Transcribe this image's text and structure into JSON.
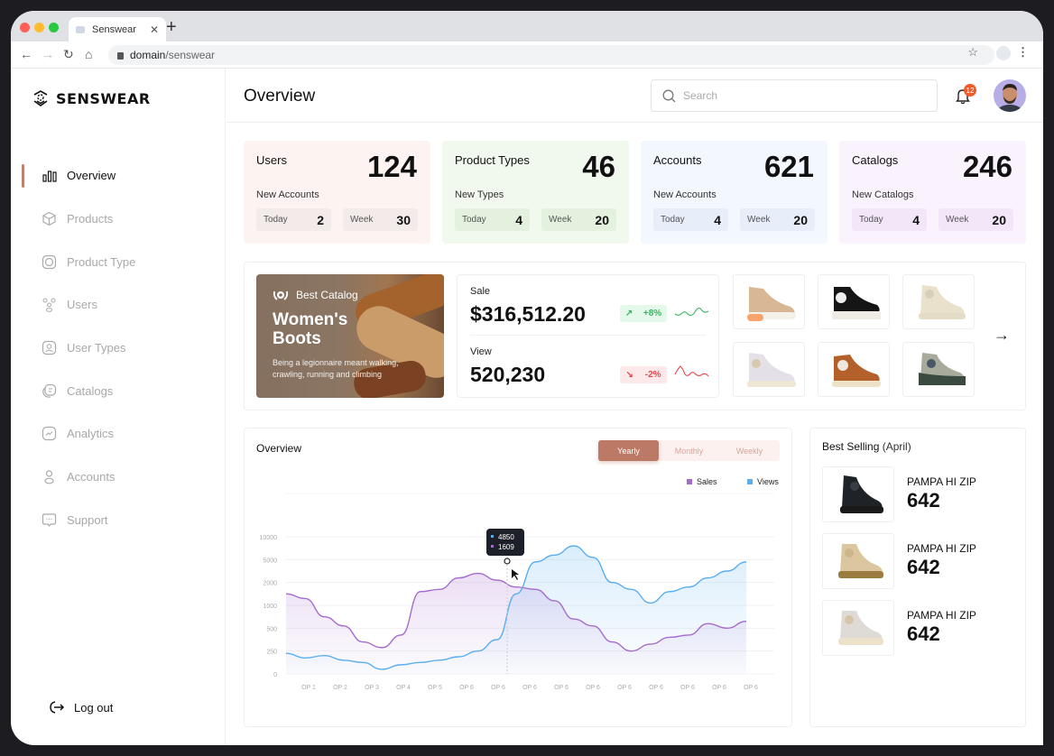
{
  "browser": {
    "tab_title": "Senswear",
    "url_domain": "domain",
    "url_path": "/senswear"
  },
  "sidebar": {
    "brand": "SENSWEAR",
    "items": [
      {
        "label": "Overview",
        "icon": "bar-chart-icon",
        "active": true
      },
      {
        "label": "Products",
        "icon": "box-icon",
        "active": false
      },
      {
        "label": "Product Type",
        "icon": "product-type-icon",
        "active": false
      },
      {
        "label": "Users",
        "icon": "users-icon",
        "active": false
      },
      {
        "label": "User Types",
        "icon": "user-types-icon",
        "active": false
      },
      {
        "label": "Catalogs",
        "icon": "catalog-icon",
        "active": false
      },
      {
        "label": "Analytics",
        "icon": "analytics-icon",
        "active": false
      },
      {
        "label": "Accounts",
        "icon": "account-icon",
        "active": false
      },
      {
        "label": "Support",
        "icon": "support-icon",
        "active": false
      }
    ],
    "logout_label": "Log out"
  },
  "header": {
    "title": "Overview",
    "search_placeholder": "Search",
    "notification_count": "12"
  },
  "stats": [
    {
      "title": "Users",
      "value": "124",
      "sub": "New Accounts",
      "today_label": "Today",
      "today": "2",
      "week_label": "Week",
      "week": "30",
      "bg": "#fdf4f2",
      "pill_bg": "#f3ebe9"
    },
    {
      "title": "Product Types",
      "value": "46",
      "sub": "New Types",
      "today_label": "Today",
      "today": "4",
      "week_label": "Week",
      "week": "20",
      "bg": "#f1f8ee",
      "pill_bg": "#e4f1de"
    },
    {
      "title": "Accounts",
      "value": "621",
      "sub": "New Accounts",
      "today_label": "Today",
      "today": "4",
      "week_label": "Week",
      "week": "20",
      "bg": "#f3f7fe",
      "pill_bg": "#e7eef9"
    },
    {
      "title": "Catalogs",
      "value": "246",
      "sub": "New Catalogs",
      "today_label": "Today",
      "today": "4",
      "week_label": "Week",
      "week": "20",
      "bg": "#faf3fd",
      "pill_bg": "#f2e6f8"
    }
  ],
  "best_catalog": {
    "label": "Best Catalog",
    "title": "Women's Boots",
    "description": "Being a legionnaire meant walking, crawling, running and climbing"
  },
  "kpis": {
    "sale_label": "Sale",
    "sale_value": "$316,512.20",
    "sale_trend": "+8%",
    "view_label": "View",
    "view_value": "520,230",
    "view_trend": "-2%",
    "up_color": "#3bb463",
    "down_color": "#e5484d"
  },
  "catalog_products": [
    {
      "name": "beige-sneaker-boot"
    },
    {
      "name": "black-high-top"
    },
    {
      "name": "cream-boot"
    },
    {
      "name": "lilac-high-top"
    },
    {
      "name": "tan-high-top"
    },
    {
      "name": "olive-boot"
    }
  ],
  "overview": {
    "title": "Overview",
    "tabs": [
      "Yearly",
      "Monthly",
      "Weekly"
    ],
    "active_tab": "Yearly",
    "tooltip": {
      "views": "4850",
      "sales": "1609"
    }
  },
  "chart_data": {
    "type": "area",
    "title": "Overview",
    "categories": [
      "OP 1",
      "OP 2",
      "OP 3",
      "OP 4",
      "OP 5",
      "OP 6",
      "OP 6",
      "OP 6",
      "OP 6",
      "OP 6",
      "OP 6",
      "OP 6",
      "OP 6",
      "OP 6",
      "OP 6"
    ],
    "y_ticks": [
      "0",
      "250",
      "500",
      "1000",
      "2000",
      "5000",
      "10000"
    ],
    "legend": "top-right",
    "grid": true,
    "series": [
      {
        "name": "Sales",
        "color": "#a56ccf",
        "values": [
          3.5,
          3.3,
          2.5,
          2.1,
          1.4,
          1.15,
          1.7,
          3.6,
          3.7,
          4.2,
          4.4,
          4.1,
          3.8,
          3.7,
          3.2,
          2.4,
          2.1,
          1.4,
          1.0,
          1.3,
          1.6,
          1.7,
          2.2,
          2.0,
          2.3
        ]
      },
      {
        "name": "Views",
        "color": "#5aaef0",
        "values": [
          0.9,
          0.7,
          0.8,
          0.6,
          0.5,
          0.2,
          0.4,
          0.5,
          0.6,
          0.75,
          1.0,
          1.5,
          3.5,
          4.9,
          5.2,
          5.6,
          5.1,
          4.0,
          3.7,
          3.1,
          3.6,
          3.8,
          4.2,
          4.5,
          4.9
        ]
      }
    ],
    "note": "values in y-tick index units (0=0, 1=250, 2=500, 3=1000, 4=2000, 5=5000, 6=10000)"
  },
  "best_selling": {
    "title": "Best Selling",
    "period": "(April)",
    "items": [
      {
        "name": "PAMPA HI ZIP",
        "value": "642"
      },
      {
        "name": "PAMPA HI ZIP",
        "value": "642"
      },
      {
        "name": "PAMPA HI ZIP",
        "value": "642"
      }
    ]
  }
}
